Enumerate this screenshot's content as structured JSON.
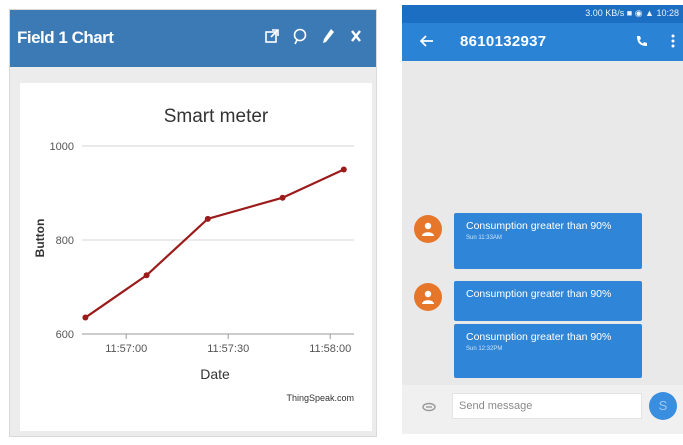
{
  "left": {
    "header_title": "Field 1 Chart",
    "icons": [
      "external-link-icon",
      "comment-icon",
      "edit-icon",
      "close-icon"
    ],
    "brand_color": "#3c7ab5"
  },
  "chart_data": {
    "type": "line",
    "title": "Smart meter",
    "xlabel": "Date",
    "ylabel": "Button",
    "x": [
      "11:56:48",
      "11:57:06",
      "11:57:24",
      "11:57:46",
      "11:58:04"
    ],
    "x_ticks": [
      "11:57:00",
      "11:57:30",
      "11:58:00"
    ],
    "x_tick_values": [
      "11:57:00",
      "11:57:30",
      "11:58:00"
    ],
    "xlim": [
      "11:56:47",
      "11:58:07"
    ],
    "y_ticks": [
      "600",
      "800",
      "1000"
    ],
    "ylim": [
      600,
      1000
    ],
    "series": [
      {
        "values": [
          635,
          725,
          845,
          890,
          950
        ],
        "color": "#9b1b1b"
      }
    ],
    "credit": "ThingSpeak.com",
    "grid": true
  },
  "right": {
    "status_text": "3.00 KB/s",
    "status_time": "10:28",
    "contact_number": "8610132937",
    "accent_color": "#2b83d6",
    "messages": [
      {
        "text": "Consumption greater than 90%",
        "time": "Sun 11:33AM"
      },
      {
        "text": "Consumption greater than 90%",
        "time": ""
      },
      {
        "text": "Consumption greater than 90%",
        "time": "Sun 12:32PM"
      }
    ],
    "compose_placeholder": "Send message",
    "send_label": "S"
  }
}
